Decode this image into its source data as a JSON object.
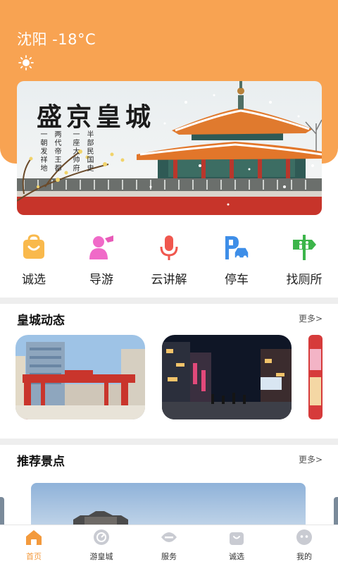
{
  "weather": {
    "city": "沈阳",
    "temperature": "-18°C",
    "display": "沈阳 -18°C",
    "icon": "sun-icon"
  },
  "banner": {
    "title": "盛京皇城",
    "columns": [
      "一朝发祥地",
      "两代帝王都",
      "一座大帅府",
      "半部民国史"
    ]
  },
  "quick_actions": [
    {
      "label": "诚选",
      "icon": "shopping-bag-icon",
      "color": "#F9B94C"
    },
    {
      "label": "导游",
      "icon": "guide-person-icon",
      "color": "#F06AC8"
    },
    {
      "label": "云讲解",
      "icon": "microphone-icon",
      "color": "#F0574E"
    },
    {
      "label": "停车",
      "icon": "parking-car-icon",
      "color": "#3E8EE8"
    },
    {
      "label": "找厕所",
      "icon": "toilet-sign-icon",
      "color": "#3CB54A"
    }
  ],
  "news": {
    "title": "皇城动态",
    "more": "更多>"
  },
  "scenic": {
    "title": "推荐景点",
    "more": "更多>"
  },
  "tabbar": [
    {
      "label": "首页",
      "icon": "home-icon",
      "active": true
    },
    {
      "label": "游皇城",
      "icon": "tour-icon",
      "active": false
    },
    {
      "label": "服务",
      "icon": "service-icon",
      "active": false
    },
    {
      "label": "诚选",
      "icon": "bag-icon",
      "active": false
    },
    {
      "label": "我的",
      "icon": "profile-icon",
      "active": false
    }
  ],
  "colors": {
    "accent": "#F8A352",
    "tab_active": "#F39A3D"
  }
}
